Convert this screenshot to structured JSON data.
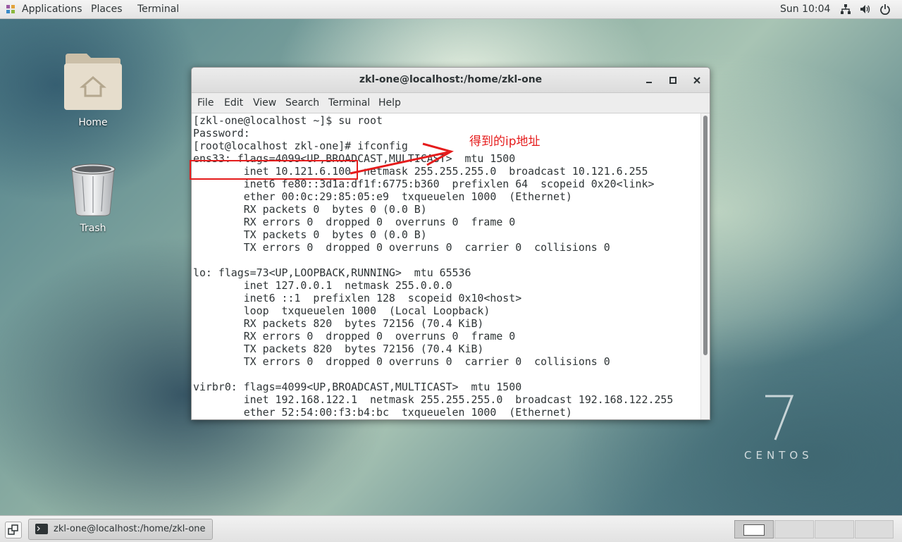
{
  "top_panel": {
    "applications": "Applications",
    "places": "Places",
    "terminal": "Terminal",
    "clock": "Sun 10:04"
  },
  "desktop": {
    "icons": [
      {
        "label": "Home"
      },
      {
        "label": "Trash"
      }
    ],
    "watermark": {
      "number": "7",
      "word": "CENTOS"
    }
  },
  "window": {
    "title": "zkl-one@localhost:/home/zkl-one",
    "menu": [
      "File",
      "Edit",
      "View",
      "Search",
      "Terminal",
      "Help"
    ],
    "terminal_lines": [
      "[zkl-one@localhost ~]$ su root",
      "Password:",
      "[root@localhost zkl-one]# ifconfig",
      "ens33: flags=4099<UP,BROADCAST,MULTICAST>  mtu 1500",
      "        inet 10.121.6.100  netmask 255.255.255.0  broadcast 10.121.6.255",
      "        inet6 fe80::3d1a:df1f:6775:b360  prefixlen 64  scopeid 0x20<link>",
      "        ether 00:0c:29:85:05:e9  txqueuelen 1000  (Ethernet)",
      "        RX packets 0  bytes 0 (0.0 B)",
      "        RX errors 0  dropped 0  overruns 0  frame 0",
      "        TX packets 0  bytes 0 (0.0 B)",
      "        TX errors 0  dropped 0 overruns 0  carrier 0  collisions 0",
      "",
      "lo: flags=73<UP,LOOPBACK,RUNNING>  mtu 65536",
      "        inet 127.0.0.1  netmask 255.0.0.0",
      "        inet6 ::1  prefixlen 128  scopeid 0x10<host>",
      "        loop  txqueuelen 1000  (Local Loopback)",
      "        RX packets 820  bytes 72156 (70.4 KiB)",
      "        RX errors 0  dropped 0  overruns 0  frame 0",
      "        TX packets 820  bytes 72156 (70.4 KiB)",
      "        TX errors 0  dropped 0 overruns 0  carrier 0  collisions 0",
      "",
      "virbr0: flags=4099<UP,BROADCAST,MULTICAST>  mtu 1500",
      "        inet 192.168.122.1  netmask 255.255.255.0  broadcast 192.168.122.255",
      "        ether 52:54:00:f3:b4:bc  txqueuelen 1000  (Ethernet)"
    ]
  },
  "annotation": {
    "text": "得到的ip地址",
    "color": "#e51c1c"
  },
  "bottom_panel": {
    "task_label": "zkl-one@localhost:/home/zkl-one"
  }
}
